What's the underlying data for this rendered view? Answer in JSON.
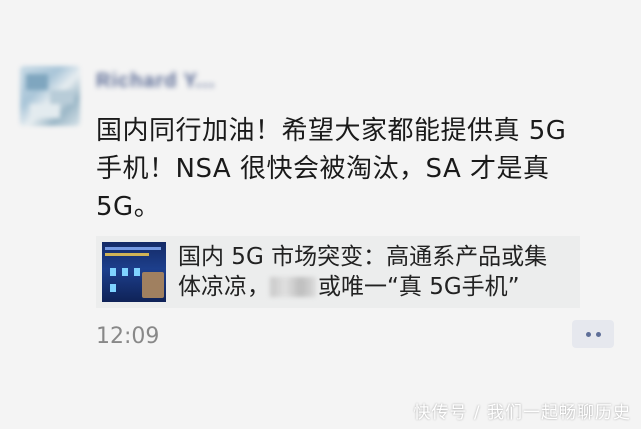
{
  "post": {
    "username": "Richard Y...",
    "content_lines": [
      "国内同行加油！希望大家都能提供真 5G",
      "手机！NSA 很快会被淘汰，SA 才是真",
      "5G。"
    ],
    "share": {
      "line1": "国内 5G 市场突变：高通系产品或集",
      "line2_prefix": "体凉凉，",
      "line2_suffix": "或唯一“真 5G手机”"
    },
    "time": "12:09"
  },
  "watermark": "快传号 / 我们一起畅聊历史"
}
